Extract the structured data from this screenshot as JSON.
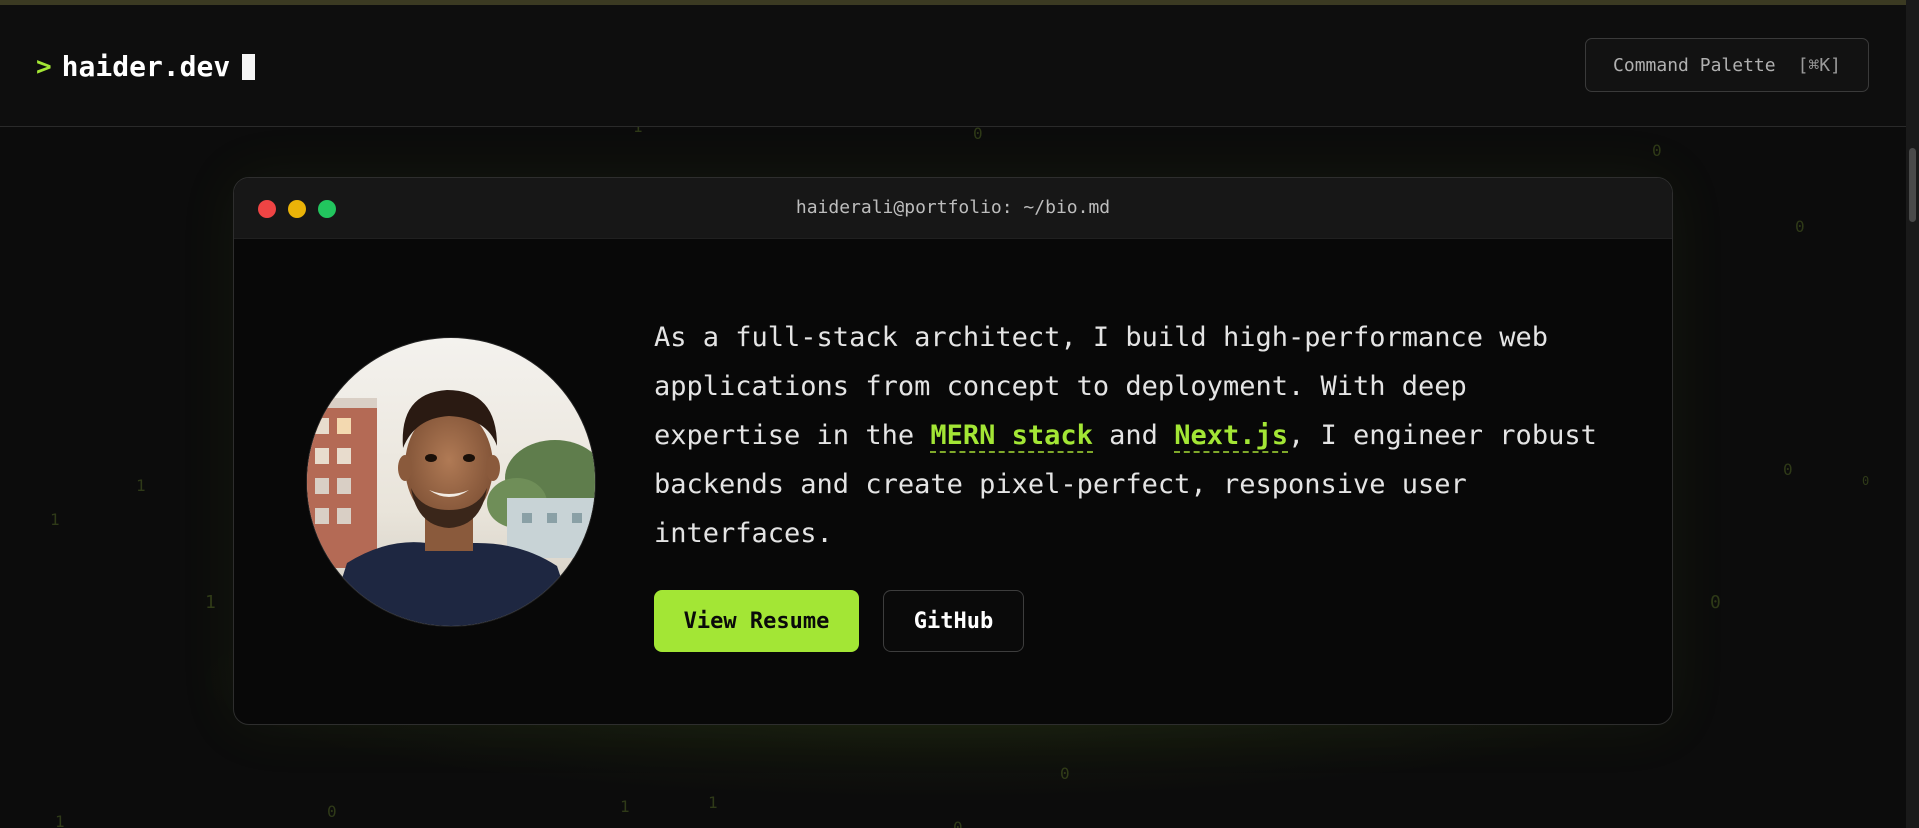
{
  "navbar": {
    "prompt_symbol": ">",
    "brand": "haider.dev",
    "command_palette": {
      "label": "Command Palette",
      "shortcut": "[⌘K]"
    }
  },
  "background_digits": [
    "1",
    "0",
    "0",
    "0",
    "1",
    "1",
    "1",
    "0",
    "0",
    "0",
    "1",
    "0",
    "1",
    "1",
    "0",
    "0"
  ],
  "terminal": {
    "title": "haiderali@portfolio: ~/bio.md",
    "bio": {
      "part1": "As a full-stack architect, I build high-performance web applications from concept to deployment. With deep expertise in the ",
      "highlight1": "MERN stack",
      "part2": " and ",
      "highlight2": "Next.js",
      "part3": ", I engineer robust backends and create pixel-perfect, responsive user interfaces."
    },
    "buttons": {
      "resume": "View Resume",
      "github": "GitHub"
    }
  },
  "colors": {
    "accent": "#a3e635",
    "background": "#0c0c0c",
    "terminal_bg": "#080808",
    "dot_red": "#ef4444",
    "dot_yellow": "#eab308",
    "dot_green": "#22c55e"
  }
}
